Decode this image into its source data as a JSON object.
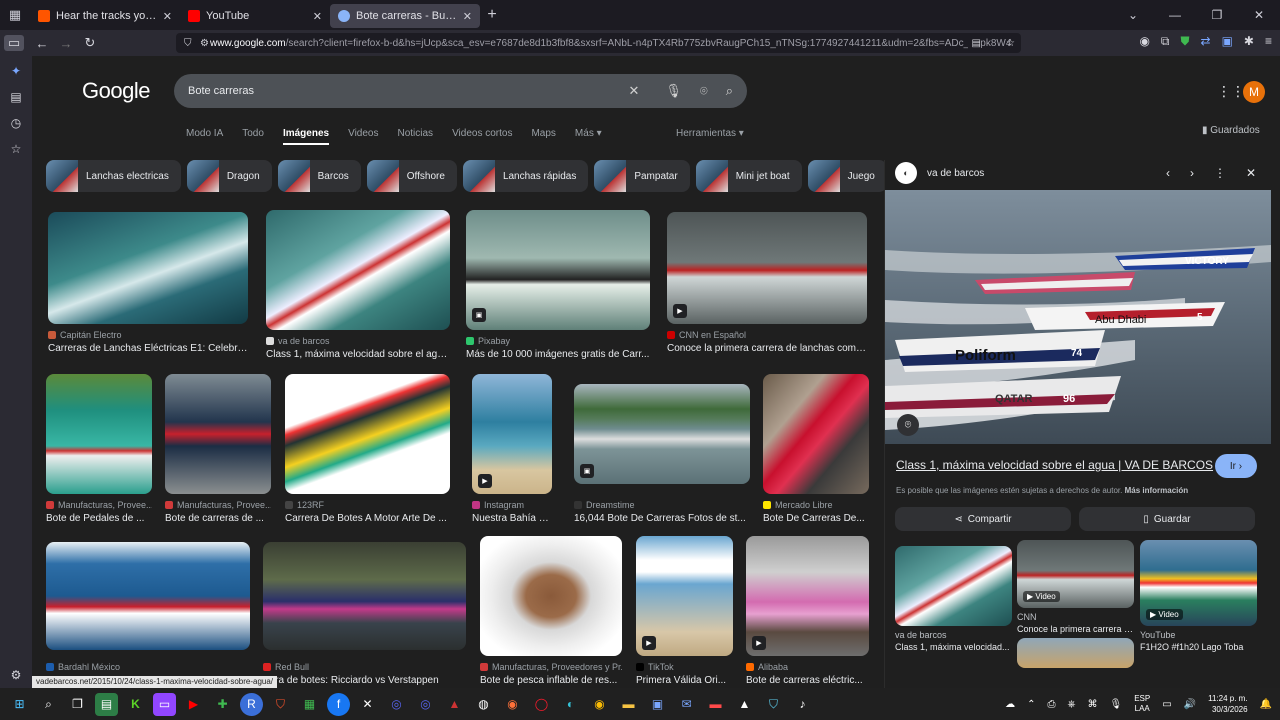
{
  "browser": {
    "tabs": [
      {
        "label": "Hear the tracks you've liked: on",
        "color": "#ff5500",
        "active": false
      },
      {
        "label": "YouTube",
        "color": "#ff0000",
        "active": false
      },
      {
        "label": "Bote carreras - Buscar con Goo",
        "color": "#8ab4f8",
        "active": true
      }
    ],
    "new_tab": "+",
    "url_domain": "www.google.com",
    "url_rest": "/search?client=firefox-b-d&hs=jUcp&sca_esv=e7687de8d1b3fbf8&sxsrf=ANbL-n4pTX4Rb775zbvRaugPCh15_nTNSg:1774927441211&udm=2&fbs=ADc_l-bpk8W4"
  },
  "google": {
    "logo": "Google",
    "query": "Bote carreras",
    "avatar_letter": "M",
    "tabs": [
      "Modo IA",
      "Todo",
      "Imágenes",
      "Videos",
      "Noticias",
      "Videos cortos",
      "Maps",
      "Más ▾"
    ],
    "tools": "Herramientas ▾",
    "saved": "Guardados"
  },
  "chips": [
    "Lanchas electricas",
    "Dragon",
    "Barcos",
    "Offshore",
    "Lanchas rápidas",
    "Pampatar",
    "Mini jet boat",
    "Juego"
  ],
  "results": [
    {
      "source": "Capitán Electro",
      "title": "Carreras de Lanchas Eléctricas E1: Celebri...",
      "fav": "#c75a3a"
    },
    {
      "source": "va de barcos",
      "title": "Class 1, máxima velocidad sobre el agu...",
      "fav": "#dddddd"
    },
    {
      "source": "Pixabay",
      "title": "Más de 10 000 imágenes gratis de Carr...",
      "fav": "#2ec66d"
    },
    {
      "source": "CNN en Español",
      "title": "Conoce la primera carrera de lanchas compl...",
      "fav": "#cc0000"
    },
    {
      "source": "Manufacturas, Provee...",
      "title": "Bote de Pedales de ...",
      "fav": "#d03a3a"
    },
    {
      "source": "Manufacturas, Provee...",
      "title": "Bote de carreras de ...",
      "fav": "#d03a3a"
    },
    {
      "source": "123RF",
      "title": "Carrera De Botes A Motor Arte De ...",
      "fav": "#444444"
    },
    {
      "source": "Instagram",
      "title": "Nuestra Bahía de ...",
      "fav": "#c13584"
    },
    {
      "source": "Dreamstime",
      "title": "16,044 Bote De Carreras Fotos de st...",
      "fav": "#333333"
    },
    {
      "source": "Mercado Libre",
      "title": "Bote De Carreras De...",
      "fav": "#ffe600"
    },
    {
      "source": "Bardahl México",
      "title": "",
      "fav": "#1c5dad"
    },
    {
      "source": "Red Bull",
      "title": "rrera de botes: Ricciardo vs Verstappen",
      "fav": "#dd2222"
    },
    {
      "source": "Manufacturas, Proveedores y Pr...",
      "title": "Bote de pesca inflable de res...",
      "fav": "#d03a3a"
    },
    {
      "source": "TikTok",
      "title": "Primera Válida Ori...",
      "fav": "#000000"
    },
    {
      "source": "Alibaba",
      "title": "Bote de carreras eléctric...",
      "fav": "#ff6a00"
    }
  ],
  "preview": {
    "source": "va de barcos",
    "title": "Class 1, máxima velocidad sobre el agua | VA DE BARCOS",
    "go": "Ir ›",
    "copyright": "Es posible que las imágenes estén sujetas a derechos de autor.",
    "more_info": "Más información",
    "share": "Compartir",
    "save": "Guardar",
    "boat_labels": [
      "VICTORY",
      "Poliform",
      "Abu Dhabi",
      "QATAR",
      "96",
      "74",
      "5"
    ],
    "related": [
      {
        "source": "va de barcos",
        "title": "Class 1, máxima velocidad...",
        "video": ""
      },
      {
        "source": "CNN",
        "title": "Conoce la primera carrera d...",
        "video": "▶ Video"
      },
      {
        "source": "YouTube",
        "title": "F1H2O #f1h20 Lago Toba",
        "video": "▶ Video"
      }
    ]
  },
  "status_url": "vadebarcos.net/2015/10/24/class-1-maxima-velocidad-sobre-agua/",
  "tray": {
    "lang": "ESP",
    "lang2": "LAA",
    "time": "11:24 p. m.",
    "date": "30/3/2026"
  }
}
